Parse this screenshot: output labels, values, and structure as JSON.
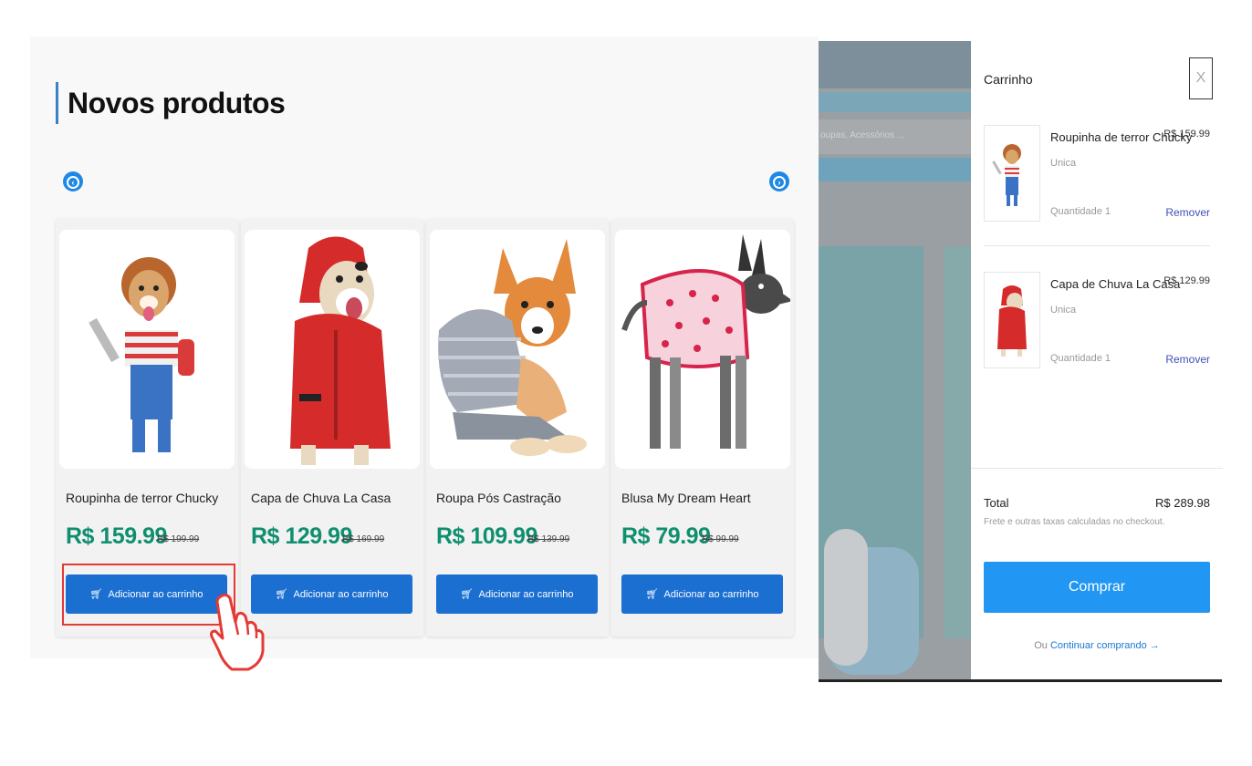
{
  "section": {
    "title": "Novos produtos"
  },
  "carousel": {
    "prev_icon": "chevron-left-icon",
    "next_icon": "chevron-right-icon"
  },
  "products": [
    {
      "name": "Roupinha de terror Chucky",
      "price": "R$ 159.99",
      "old_price": "R$ 199.99",
      "button": "Adicionar ao carrinho"
    },
    {
      "name": "Capa de Chuva La Casa",
      "price": "R$ 129.99",
      "old_price": "R$ 169.99",
      "button": "Adicionar ao carrinho"
    },
    {
      "name": "Roupa Pós Castração",
      "price": "R$ 109.99",
      "old_price": "R$ 139.99",
      "button": "Adicionar ao carrinho"
    },
    {
      "name": "Blusa My Dream Heart",
      "price": "R$ 79.99",
      "old_price": "R$ 99.99",
      "button": "Adicionar ao carrinho"
    }
  ],
  "background_page": {
    "search_placeholder": "oupas, Acessórios ..."
  },
  "cart": {
    "title": "Carrinho",
    "close_label": "X",
    "items": [
      {
        "name": "Roupinha de terror Chucky",
        "price": "R$ 159.99",
        "variant": "Unica",
        "quantity": "Quantidade 1",
        "remove": "Remover"
      },
      {
        "name": "Capa de Chuva La Casa",
        "price": "R$ 129.99",
        "variant": "Unica",
        "quantity": "Quantidade 1",
        "remove": "Remover"
      }
    ],
    "total_label": "Total",
    "total_value": "R$ 289.98",
    "tax_note": "Frete e outras taxas calculadas no checkout.",
    "buy_button": "Comprar",
    "continue_prefix": "Ou",
    "continue_link": "Continuar comprando →"
  },
  "colors": {
    "accent": "#1b6fd1",
    "price_green": "#0f8f6f",
    "buy_blue": "#2196f3",
    "highlight_red": "#e53935"
  }
}
